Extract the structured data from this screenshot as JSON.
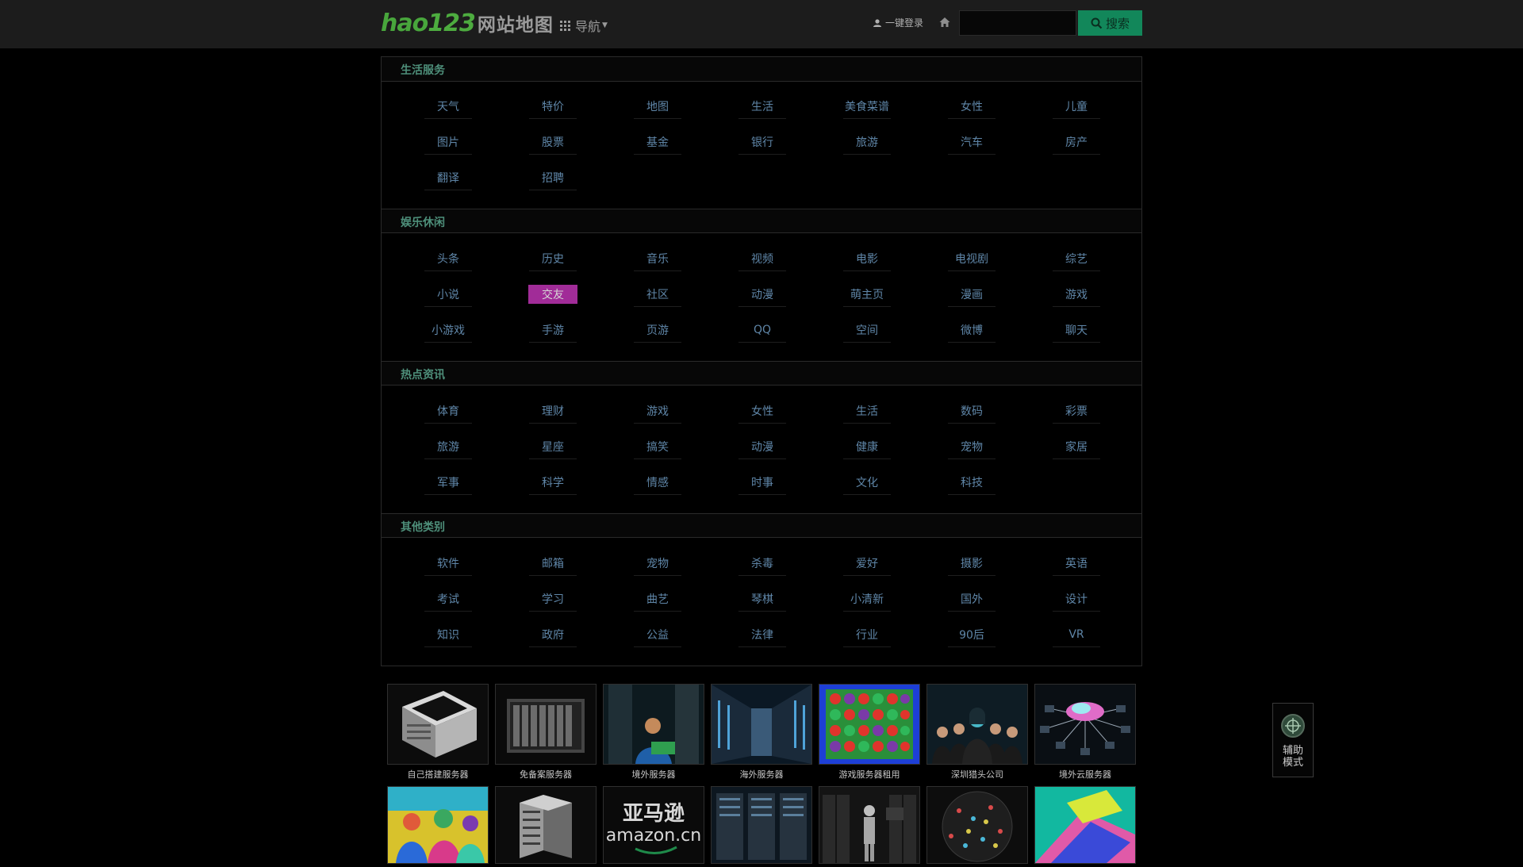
{
  "header": {
    "logo_brand": "hao",
    "logo_num": "123",
    "logo_sub": "网站地图",
    "nav_label": "导航",
    "login_label": "一键登录",
    "search_placeholder": "",
    "search_button": "搜索"
  },
  "sections": [
    {
      "title": "生活服务",
      "links": [
        "天气",
        "特价",
        "地图",
        "生活",
        "美食菜谱",
        "女性",
        "儿童",
        "图片",
        "股票",
        "基金",
        "银行",
        "旅游",
        "汽车",
        "房产",
        "翻译",
        "招聘"
      ]
    },
    {
      "title": "娱乐休闲",
      "links": [
        "头条",
        "历史",
        "音乐",
        "视频",
        "电影",
        "电视剧",
        "综艺",
        "小说",
        "交友",
        "社区",
        "动漫",
        "萌主页",
        "漫画",
        "游戏",
        "小游戏",
        "手游",
        "页游",
        "QQ",
        "空间",
        "微博",
        "聊天"
      ]
    },
    {
      "title": "热点资讯",
      "links": [
        "体育",
        "理财",
        "游戏",
        "女性",
        "生活",
        "数码",
        "彩票",
        "旅游",
        "星座",
        "搞笑",
        "动漫",
        "健康",
        "宠物",
        "家居",
        "军事",
        "科学",
        "情感",
        "时事",
        "文化",
        "科技"
      ]
    },
    {
      "title": "其他类别",
      "links": [
        "软件",
        "邮箱",
        "宠物",
        "杀毒",
        "爱好",
        "摄影",
        "英语",
        "考试",
        "学习",
        "曲艺",
        "琴棋",
        "小清新",
        "国外",
        "设计",
        "知识",
        "政府",
        "公益",
        "法律",
        "行业",
        "90后",
        "VR"
      ]
    }
  ],
  "active_link": "交友",
  "thumbnails": [
    {
      "caption": "自己搭建服务器",
      "icon": "server-tower"
    },
    {
      "caption": "免备案服务器",
      "icon": "blade-server"
    },
    {
      "caption": "境外服务器",
      "icon": "technician"
    },
    {
      "caption": "海外服务器",
      "icon": "datacenter-aisle"
    },
    {
      "caption": "游戏服务器租用",
      "icon": "game-grid"
    },
    {
      "caption": "深圳猎头公司",
      "icon": "business-team"
    },
    {
      "caption": "境外云服务器",
      "icon": "cloud-network"
    },
    {
      "caption": "",
      "icon": "colorful-people"
    },
    {
      "caption": "",
      "icon": "server-racks"
    },
    {
      "caption": "",
      "icon": "amazon-logo",
      "logo_cn": "亚马逊",
      "logo_en": "amazon.cn"
    },
    {
      "caption": "",
      "icon": "datacenter-racks"
    },
    {
      "caption": "",
      "icon": "graduate-figure"
    },
    {
      "caption": "",
      "icon": "network-circle"
    },
    {
      "caption": "",
      "icon": "colorful-tech"
    }
  ],
  "assist_widget": {
    "label": "辅助模式"
  },
  "colors": {
    "background": "#000000",
    "topbar": "#1c1c1c",
    "section_title": "#4e8f7a",
    "link": "#5f86a8",
    "active_link_bg": "#a12c98",
    "search_button": "#12875a",
    "logo_green": "#48a63c"
  }
}
